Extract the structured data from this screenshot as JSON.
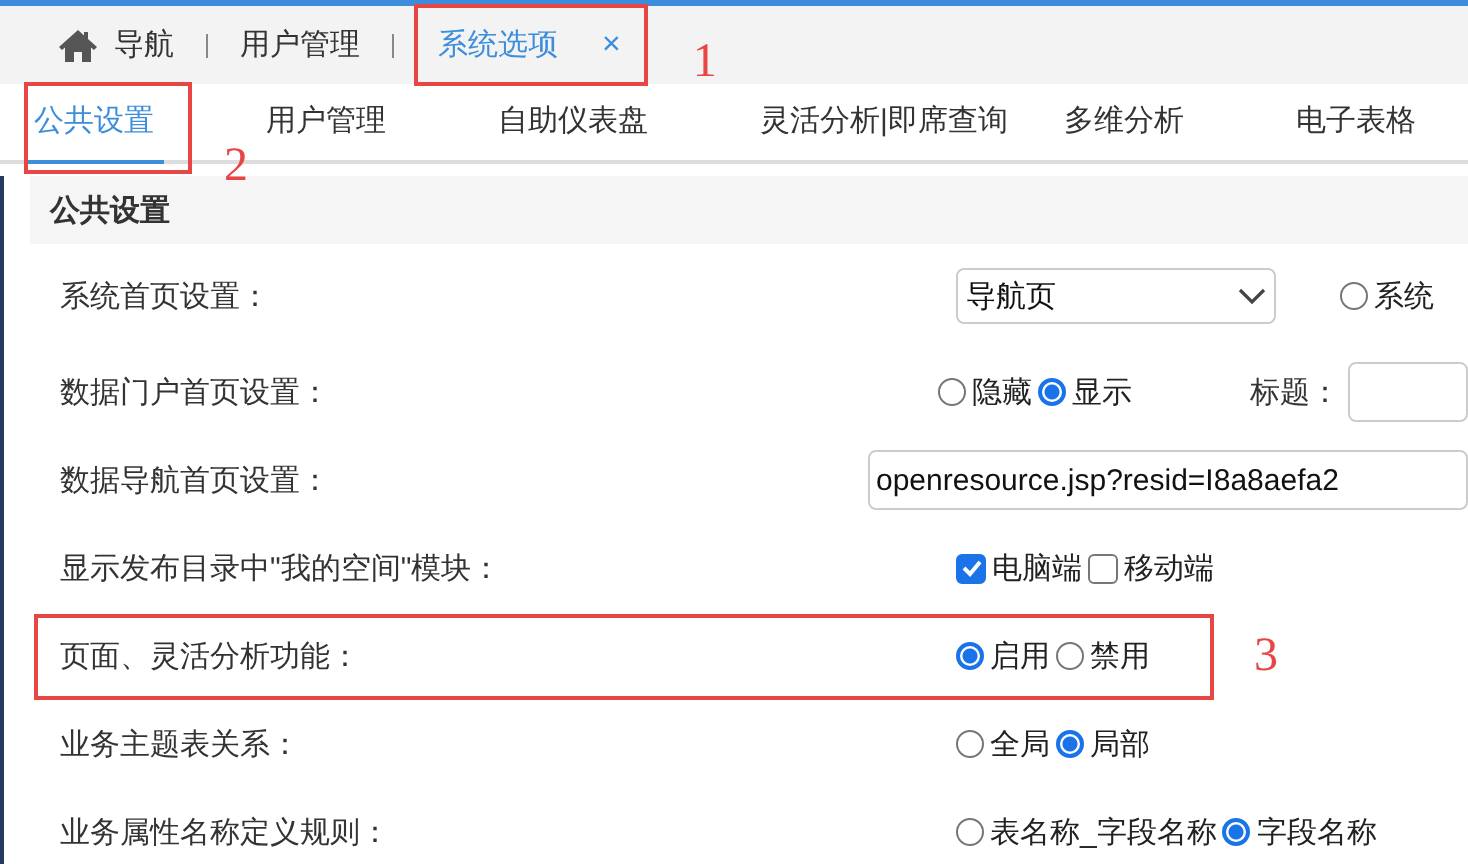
{
  "nav_tabs": [
    {
      "kind": "home",
      "label": "导航",
      "selected": false
    },
    {
      "kind": "plain",
      "label": "用户管理",
      "selected": false
    },
    {
      "kind": "closable",
      "label": "系统选项",
      "selected": true,
      "close_label": "×",
      "annotation": "1"
    }
  ],
  "settings_tabs": [
    {
      "label": "公共设置",
      "selected": true,
      "annotation": "2"
    },
    {
      "label": "用户管理",
      "selected": false
    },
    {
      "label": "自助仪表盘",
      "selected": false
    },
    {
      "label": "灵活分析|即席查询",
      "selected": false
    },
    {
      "label": "多维分析",
      "selected": false
    },
    {
      "label": "电子表格",
      "selected": false
    }
  ],
  "section_title": "公共设置",
  "rows": [
    {
      "label": "系统首页设置：",
      "controls": [
        {
          "kind": "select",
          "value": "导航页"
        },
        {
          "kind": "radio",
          "label": "系统",
          "selected": false
        }
      ]
    },
    {
      "label": "数据门户首页设置：",
      "controls": [
        {
          "kind": "radio",
          "label": "隐藏",
          "selected": false
        },
        {
          "kind": "radio",
          "label": "显示",
          "selected": true
        },
        {
          "kind": "field",
          "label": "标题："
        }
      ]
    },
    {
      "label": "数据导航首页设置：",
      "controls": [
        {
          "kind": "field",
          "value": "openresource.jsp?resid=I8a8aefa2"
        }
      ]
    },
    {
      "label": "显示发布目录中\"我的空间\"模块：",
      "controls": [
        {
          "kind": "checkbox",
          "label": "电脑端",
          "checked": true
        },
        {
          "kind": "checkbox",
          "label": "移动端",
          "checked": false
        }
      ]
    },
    {
      "label": "页面、灵活分析功能：",
      "annotation": "3",
      "controls": [
        {
          "kind": "radio",
          "label": "启用",
          "selected": true
        },
        {
          "kind": "radio",
          "label": "禁用",
          "selected": false
        }
      ]
    },
    {
      "label": "业务主题表关系：",
      "controls": [
        {
          "kind": "radio",
          "label": "全局",
          "selected": false
        },
        {
          "kind": "radio",
          "label": "局部",
          "selected": true
        }
      ]
    },
    {
      "label": "业务属性名称定义规则：",
      "controls": [
        {
          "kind": "radio",
          "label": "表名称_字段名称",
          "selected": false
        },
        {
          "kind": "radio",
          "label": "字段名称",
          "selected": true
        }
      ]
    }
  ]
}
